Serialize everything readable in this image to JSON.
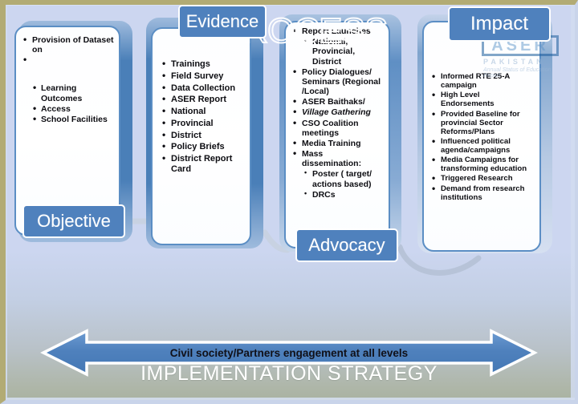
{
  "slide": {
    "footer_title": "IMPLEMENTATION STRATEGY",
    "arrow_caption": "Civil society/Partners engagement at all levels",
    "watermark_word": "PROCESS",
    "accent_color": "#4f81bd",
    "card_border_color": "#5b8ec4",
    "background_top_color": "#ccd6f0",
    "background_bottom_color": "#a8b19f"
  },
  "logo": {
    "name": "ASER",
    "country": "PAKISTAN",
    "tagline": "Annual Status of Education Report"
  },
  "labels": {
    "objective": "Objective",
    "evidence": "Evidence",
    "advocacy": "Advocacy",
    "impact": "Impact"
  },
  "cards": [
    {
      "id": "objective",
      "label": "Objective",
      "items": [
        {
          "text": "Provision of Dataset on",
          "level": 0
        },
        {
          "text": "",
          "level": "spacer"
        },
        {
          "text": "Learning Outcomes",
          "level": 1
        },
        {
          "text": "Access",
          "level": 1
        },
        {
          "text": "School Facilities",
          "level": 1
        }
      ]
    },
    {
      "id": "evidence",
      "label": "Evidence",
      "items": [
        {
          "text": "Trainings",
          "level": 0
        },
        {
          "text": "Field Survey",
          "level": 0
        },
        {
          "text": "Data Collection",
          "level": 0
        },
        {
          "text": "ASER Report",
          "level": 0
        },
        {
          "text": "National",
          "level": 0
        },
        {
          "text": "Provincial",
          "level": 0
        },
        {
          "text": "District",
          "level": 0
        },
        {
          "text": "Policy  Briefs",
          "level": 0
        },
        {
          "text": "District Report Card",
          "level": 0
        }
      ]
    },
    {
      "id": "advocacy",
      "label": "Advocacy",
      "items": [
        {
          "text": "Report Launches",
          "level": 0
        },
        {
          "text": "National, Provincial, District",
          "level": 1
        },
        {
          "text": "Policy Dialogues/ Seminars (Regional /Local)",
          "level": 0
        },
        {
          "text": "ASER Baithaks/",
          "level": 0
        },
        {
          "text": "Village Gathering",
          "level": 0,
          "style": "italic"
        },
        {
          "text": "CSO Coalition meetings",
          "level": 0
        },
        {
          "text": "Media Training",
          "level": 0
        },
        {
          "text": "Mass dissemination:",
          "level": 0
        },
        {
          "text": "Poster ( target/ actions based)",
          "level": 1
        },
        {
          "text": "DRCs",
          "level": 1
        }
      ]
    },
    {
      "id": "impact",
      "label": "Impact",
      "items": [
        {
          "text": "Informed RTE 25-A campaign",
          "level": 0
        },
        {
          "text": "High Level Endorsements",
          "level": 0
        },
        {
          "text": "Provided Baseline for provincial Sector Reforms/Plans",
          "level": 0
        },
        {
          "text": "Influenced political agenda/campaigns",
          "level": 0
        },
        {
          "text": "Media Campaigns for transforming education",
          "level": 0
        },
        {
          "text": "Triggered  Research",
          "level": 0
        },
        {
          "text": "Demand from research institutions",
          "level": 0
        }
      ]
    }
  ]
}
